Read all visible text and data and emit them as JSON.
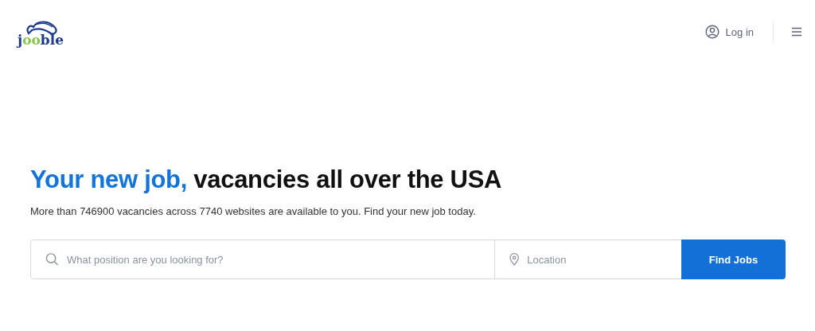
{
  "header": {
    "logo": {
      "lead": "j",
      "accent": "oo",
      "rest": "ble"
    },
    "login": "Log in"
  },
  "hero": {
    "headline_accent": "Your new job,",
    "headline_rest": "vacancies all over the USA",
    "subtitle": "More than 746900 vacancies across 7740 websites are available to you. Find your new job today."
  },
  "search": {
    "position_placeholder": "What position are you looking for?",
    "location_placeholder": "Location",
    "button": "Find Jobs"
  }
}
